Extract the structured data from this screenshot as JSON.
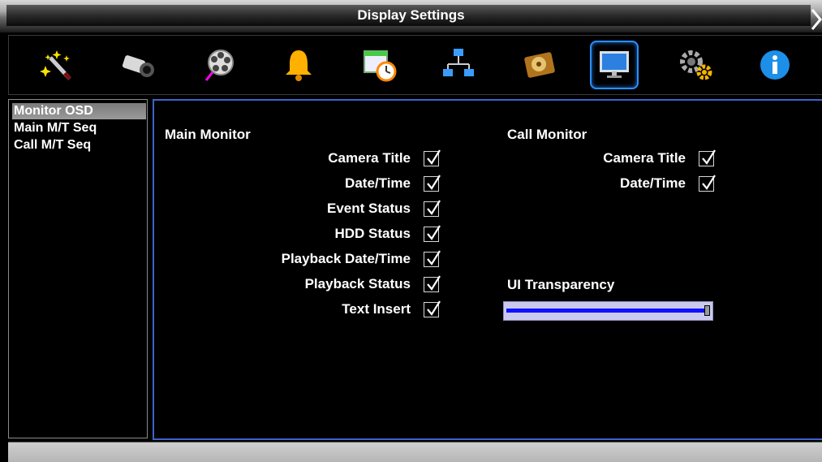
{
  "window": {
    "title": "Display Settings"
  },
  "toolbar": {
    "icons": [
      {
        "name": "wizard-wand-icon"
      },
      {
        "name": "camera-icon"
      },
      {
        "name": "film-reel-icon"
      },
      {
        "name": "bell-icon"
      },
      {
        "name": "schedule-clock-icon"
      },
      {
        "name": "network-icon"
      },
      {
        "name": "hdd-icon"
      },
      {
        "name": "monitor-icon",
        "active": true
      },
      {
        "name": "gears-icon"
      },
      {
        "name": "info-icon"
      }
    ]
  },
  "sidebar": {
    "items": [
      {
        "label": "Monitor OSD",
        "selected": true
      },
      {
        "label": "Main M/T Seq",
        "selected": false
      },
      {
        "label": "Call M/T Seq",
        "selected": false
      }
    ]
  },
  "main_monitor": {
    "title": "Main Monitor",
    "options": [
      {
        "label": "Camera Title",
        "checked": true
      },
      {
        "label": "Date/Time",
        "checked": true
      },
      {
        "label": "Event Status",
        "checked": true
      },
      {
        "label": "HDD Status",
        "checked": true
      },
      {
        "label": "Playback Date/Time",
        "checked": true
      },
      {
        "label": "Playback Status",
        "checked": true
      },
      {
        "label": "Text Insert",
        "checked": true
      }
    ]
  },
  "call_monitor": {
    "title": "Call Monitor",
    "options": [
      {
        "label": "Camera Title",
        "checked": true
      },
      {
        "label": "Date/Time",
        "checked": true
      }
    ]
  },
  "ui_transparency": {
    "title": "UI Transparency",
    "value_fraction": 1.0
  },
  "colors": {
    "accent_border": "#3e64c9",
    "slider_fill": "#1010ff",
    "active_tool_border": "#2a8fff"
  }
}
